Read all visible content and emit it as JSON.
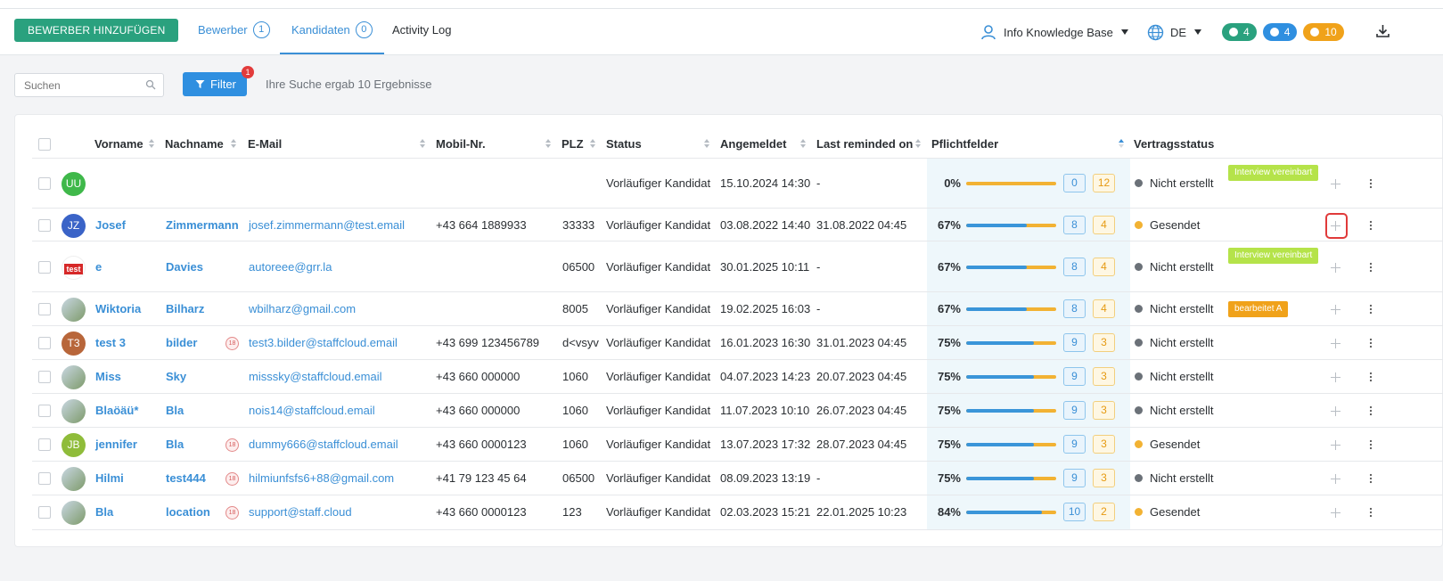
{
  "header": {
    "add_button": "BEWERBER HINZUFÜGEN",
    "tabs": [
      {
        "label": "Bewerber",
        "count": "1"
      },
      {
        "label": "Kandidaten",
        "count": "0"
      },
      {
        "label": "Activity Log"
      }
    ],
    "user_menu": "Info Knowledge Base",
    "language": "DE",
    "badges": {
      "messages": "4",
      "notifications": "4",
      "timers": "10"
    },
    "colors": {
      "brand_green": "#2aa17e",
      "accent_blue": "#3a8fd6",
      "badge_green": "#2aa17e",
      "badge_blue": "#2f8fe0",
      "badge_orange": "#f0a21a"
    }
  },
  "toolbar": {
    "search_placeholder": "Suchen",
    "filter_label": "Filter",
    "filter_badge": "1",
    "result_text": "Ihre Suche ergab 10 Ergebnisse"
  },
  "table": {
    "columns": [
      "Vorname",
      "Nachname",
      "E-Mail",
      "Mobil-Nr.",
      "PLZ",
      "Status",
      "Angemeldet",
      "Last reminded on",
      "Pflichtfelder",
      "Vertragsstatus"
    ],
    "rows": [
      {
        "avatar": "UU",
        "vorname": "",
        "nachname": "",
        "age": "",
        "email": "",
        "mobil": "",
        "plz": "",
        "status": "Vorläufiger Kandidat",
        "angemeldet": "15.10.2024 14:30",
        "reminded": "-",
        "pflicht_pct": "0%",
        "progress": 0,
        "filled": "0",
        "missing": "12",
        "vertrag": "Nicht erstellt",
        "vertrag_color": "#6b7178",
        "tag": "Interview vereinbart",
        "tag_color": "#b5e34a"
      },
      {
        "avatar": "JZ",
        "vorname": "Josef",
        "nachname": "Zimmermann",
        "age": "",
        "email": "josef.zimmermann@test.email",
        "mobil": "+43 664 1889933",
        "plz": "33333",
        "status": "Vorläufiger Kandidat",
        "angemeldet": "03.08.2022 14:40",
        "reminded": "31.08.2022 04:45",
        "pflicht_pct": "67%",
        "progress": 0.67,
        "filled": "8",
        "missing": "4",
        "vertrag": "Gesendet",
        "vertrag_color": "#f2b233",
        "tag": "",
        "tag_color": ""
      },
      {
        "avatar": "test",
        "vorname": "e",
        "nachname": "Davies",
        "age": "",
        "email": "autoreee@grr.la",
        "mobil": "",
        "plz": "06500",
        "status": "Vorläufiger Kandidat",
        "angemeldet": "30.01.2025 10:11",
        "reminded": "-",
        "pflicht_pct": "67%",
        "progress": 0.67,
        "filled": "8",
        "missing": "4",
        "vertrag": "Nicht erstellt",
        "vertrag_color": "#6b7178",
        "tag": "Interview vereinbart",
        "tag_color": "#b5e34a"
      },
      {
        "avatar": "",
        "vorname": "Wiktoria",
        "nachname": "Bilharz",
        "age": "",
        "email": "wbilharz@gmail.com",
        "mobil": "",
        "plz": "8005",
        "status": "Vorläufiger Kandidat",
        "angemeldet": "19.02.2025 16:03",
        "reminded": "-",
        "pflicht_pct": "67%",
        "progress": 0.67,
        "filled": "8",
        "missing": "4",
        "vertrag": "Nicht erstellt",
        "vertrag_color": "#6b7178",
        "tag": "bearbeitet A",
        "tag_color": "#f0a21a"
      },
      {
        "avatar": "T3",
        "vorname": "test 3",
        "nachname": "bilder",
        "age": "18",
        "email": "test3.bilder@staffcloud.email",
        "mobil": "+43 699 123456789",
        "plz": "d<vsyv",
        "status": "Vorläufiger Kandidat",
        "angemeldet": "16.01.2023 16:30",
        "reminded": "31.01.2023 04:45",
        "pflicht_pct": "75%",
        "progress": 0.75,
        "filled": "9",
        "missing": "3",
        "vertrag": "Nicht erstellt",
        "vertrag_color": "#6b7178",
        "tag": "",
        "tag_color": ""
      },
      {
        "avatar": "",
        "vorname": "Miss",
        "nachname": "Sky",
        "age": "",
        "email": "misssky@staffcloud.email",
        "mobil": "+43 660 000000",
        "plz": "1060",
        "status": "Vorläufiger Kandidat",
        "angemeldet": "04.07.2023 14:23",
        "reminded": "20.07.2023 04:45",
        "pflicht_pct": "75%",
        "progress": 0.75,
        "filled": "9",
        "missing": "3",
        "vertrag": "Nicht erstellt",
        "vertrag_color": "#6b7178",
        "tag": "",
        "tag_color": ""
      },
      {
        "avatar": "",
        "vorname": "Blaöäü*",
        "nachname": "Bla",
        "age": "",
        "email": "nois14@staffcloud.email",
        "mobil": "+43 660 000000",
        "plz": "1060",
        "status": "Vorläufiger Kandidat",
        "angemeldet": "11.07.2023 10:10",
        "reminded": "26.07.2023 04:45",
        "pflicht_pct": "75%",
        "progress": 0.75,
        "filled": "9",
        "missing": "3",
        "vertrag": "Nicht erstellt",
        "vertrag_color": "#6b7178",
        "tag": "",
        "tag_color": ""
      },
      {
        "avatar": "JB",
        "vorname": "jennifer",
        "nachname": "Bla",
        "age": "18",
        "email": "dummy666@staffcloud.email",
        "mobil": "+43 660 0000123",
        "plz": "1060",
        "status": "Vorläufiger Kandidat",
        "angemeldet": "13.07.2023 17:32",
        "reminded": "28.07.2023 04:45",
        "pflicht_pct": "75%",
        "progress": 0.75,
        "filled": "9",
        "missing": "3",
        "vertrag": "Gesendet",
        "vertrag_color": "#f2b233",
        "tag": "",
        "tag_color": ""
      },
      {
        "avatar": "",
        "vorname": "Hilmi",
        "nachname": "test444",
        "age": "18",
        "email": "hilmiunfsfs6+88@gmail.com",
        "mobil": "+41 79 123 45 64",
        "plz": "06500",
        "status": "Vorläufiger Kandidat",
        "angemeldet": "08.09.2023 13:19",
        "reminded": "-",
        "pflicht_pct": "75%",
        "progress": 0.75,
        "filled": "9",
        "missing": "3",
        "vertrag": "Nicht erstellt",
        "vertrag_color": "#6b7178",
        "tag": "",
        "tag_color": ""
      },
      {
        "avatar": "",
        "vorname": "Bla",
        "nachname": "location",
        "age": "18",
        "email": "support@staff.cloud",
        "mobil": "+43 660 0000123",
        "plz": "123",
        "status": "Vorläufiger Kandidat",
        "angemeldet": "02.03.2023 15:21",
        "reminded": "22.01.2025 10:23",
        "pflicht_pct": "84%",
        "progress": 0.84,
        "filled": "10",
        "missing": "2",
        "vertrag": "Gesendet",
        "vertrag_color": "#f2b233",
        "tag": "",
        "tag_color": ""
      }
    ]
  }
}
